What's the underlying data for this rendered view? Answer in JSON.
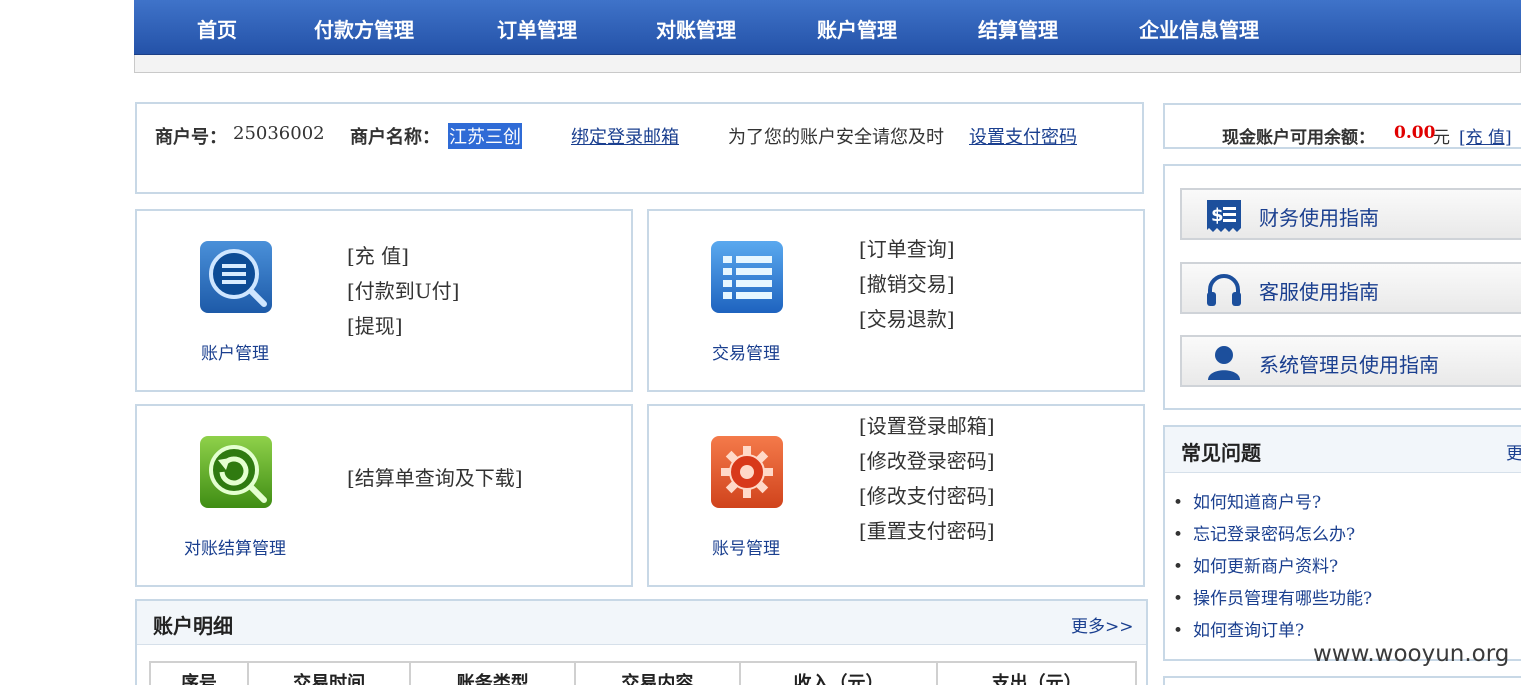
{
  "nav": {
    "items": [
      "首页",
      "付款方管理",
      "订单管理",
      "对账管理",
      "账户管理",
      "结算管理",
      "企业信息管理"
    ]
  },
  "merchant": {
    "id_label": "商户号：",
    "id_value": "25036002",
    "name_label": "商户名称：",
    "name_value": "江苏三创",
    "bind_email_link": "绑定登录邮箱",
    "security_text": "为了您的账户安全请您及时",
    "set_pay_password_link": "设置支付密码"
  },
  "features": {
    "account": {
      "caption": "账户管理",
      "icon": "magnifier-list-icon",
      "links": [
        "[充 值]",
        "[付款到U付]",
        "[提现]"
      ]
    },
    "trade": {
      "caption": "交易管理",
      "icon": "list-icon",
      "links": [
        "[订单查询]",
        "[撤销交易]",
        "[交易退款]"
      ]
    },
    "settle": {
      "caption": "对账结算管理",
      "icon": "refresh-arrow-icon",
      "links": [
        "[结算单查询及下载]"
      ]
    },
    "acct_no": {
      "caption": "账号管理",
      "icon": "gear-icon",
      "links": [
        "[设置登录邮箱]",
        "[修改登录密码]",
        "[修改支付密码]",
        "[重置支付密码]"
      ]
    }
  },
  "balance": {
    "label": "现金账户可用余额：",
    "amount": "0.00",
    "unit": "元",
    "recharge_link": "[充 值]"
  },
  "guides": [
    {
      "label": "财务使用指南",
      "icon": "dollar-receipt-icon"
    },
    {
      "label": "客服使用指南",
      "icon": "headset-icon"
    },
    {
      "label": "系统管理员使用指南",
      "icon": "user-icon"
    }
  ],
  "faq": {
    "title": "常见问题",
    "more": "更",
    "items": [
      "如何知道商户号?",
      "忘记登录密码怎么办?",
      "如何更新商户资料?",
      "操作员管理有哪些功能?",
      "如何查询订单?"
    ]
  },
  "detail": {
    "title": "账户明细",
    "more": "更多>>",
    "columns": [
      "序号",
      "交易时间",
      "账务类型",
      "交易内容",
      "收入（元）",
      "支出（元）"
    ]
  },
  "watermark": "www.wooyun.org",
  "colors": {
    "nav_top": "#3f73c9",
    "nav_bottom": "#2452a8",
    "link": "#1a3f8f",
    "amount": "#e00000",
    "panel_border": "#c8d8e6"
  }
}
